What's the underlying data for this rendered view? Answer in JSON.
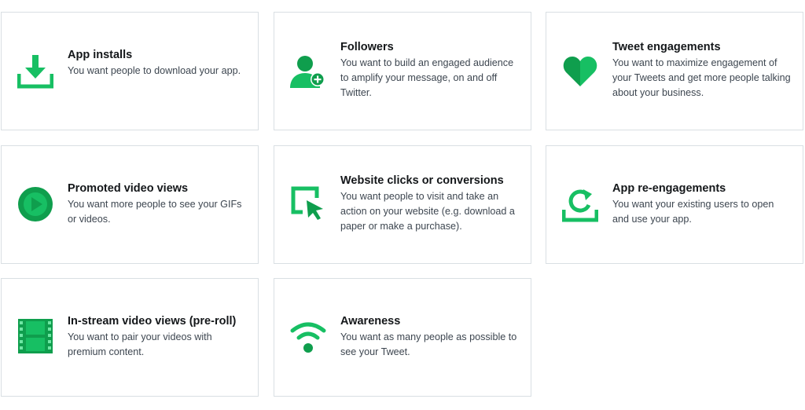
{
  "colors": {
    "accent": "#17bf63",
    "accent_dark": "#0f9e4d",
    "border": "#d9dfe3"
  },
  "objectives": [
    {
      "title": "App installs",
      "description": "You want people to download your app.",
      "icon": "download-icon"
    },
    {
      "title": "Followers",
      "description": "You want to build an engaged audience to amplify your message, on and off Twitter.",
      "icon": "add-follower-icon"
    },
    {
      "title": "Tweet engagements",
      "description": "You want to maximize engagement of your Tweets and get more people talking about your business.",
      "icon": "heart-icon"
    },
    {
      "title": "Promoted video views",
      "description": "You want more people to see your GIFs or videos.",
      "icon": "play-icon"
    },
    {
      "title": "Website clicks or conversions",
      "description": "You want people to visit and take an action on your website (e.g. download a paper or make a purchase).",
      "icon": "cursor-click-icon"
    },
    {
      "title": "App re-engagements",
      "description": "You want your existing users to open and use your app.",
      "icon": "refresh-app-icon"
    },
    {
      "title": "In-stream video views (pre-roll)",
      "description": "You want to pair your videos with premium content.",
      "icon": "film-strip-icon"
    },
    {
      "title": "Awareness",
      "description": "You want as many people as possible to see your Tweet.",
      "icon": "wifi-signal-icon"
    }
  ]
}
